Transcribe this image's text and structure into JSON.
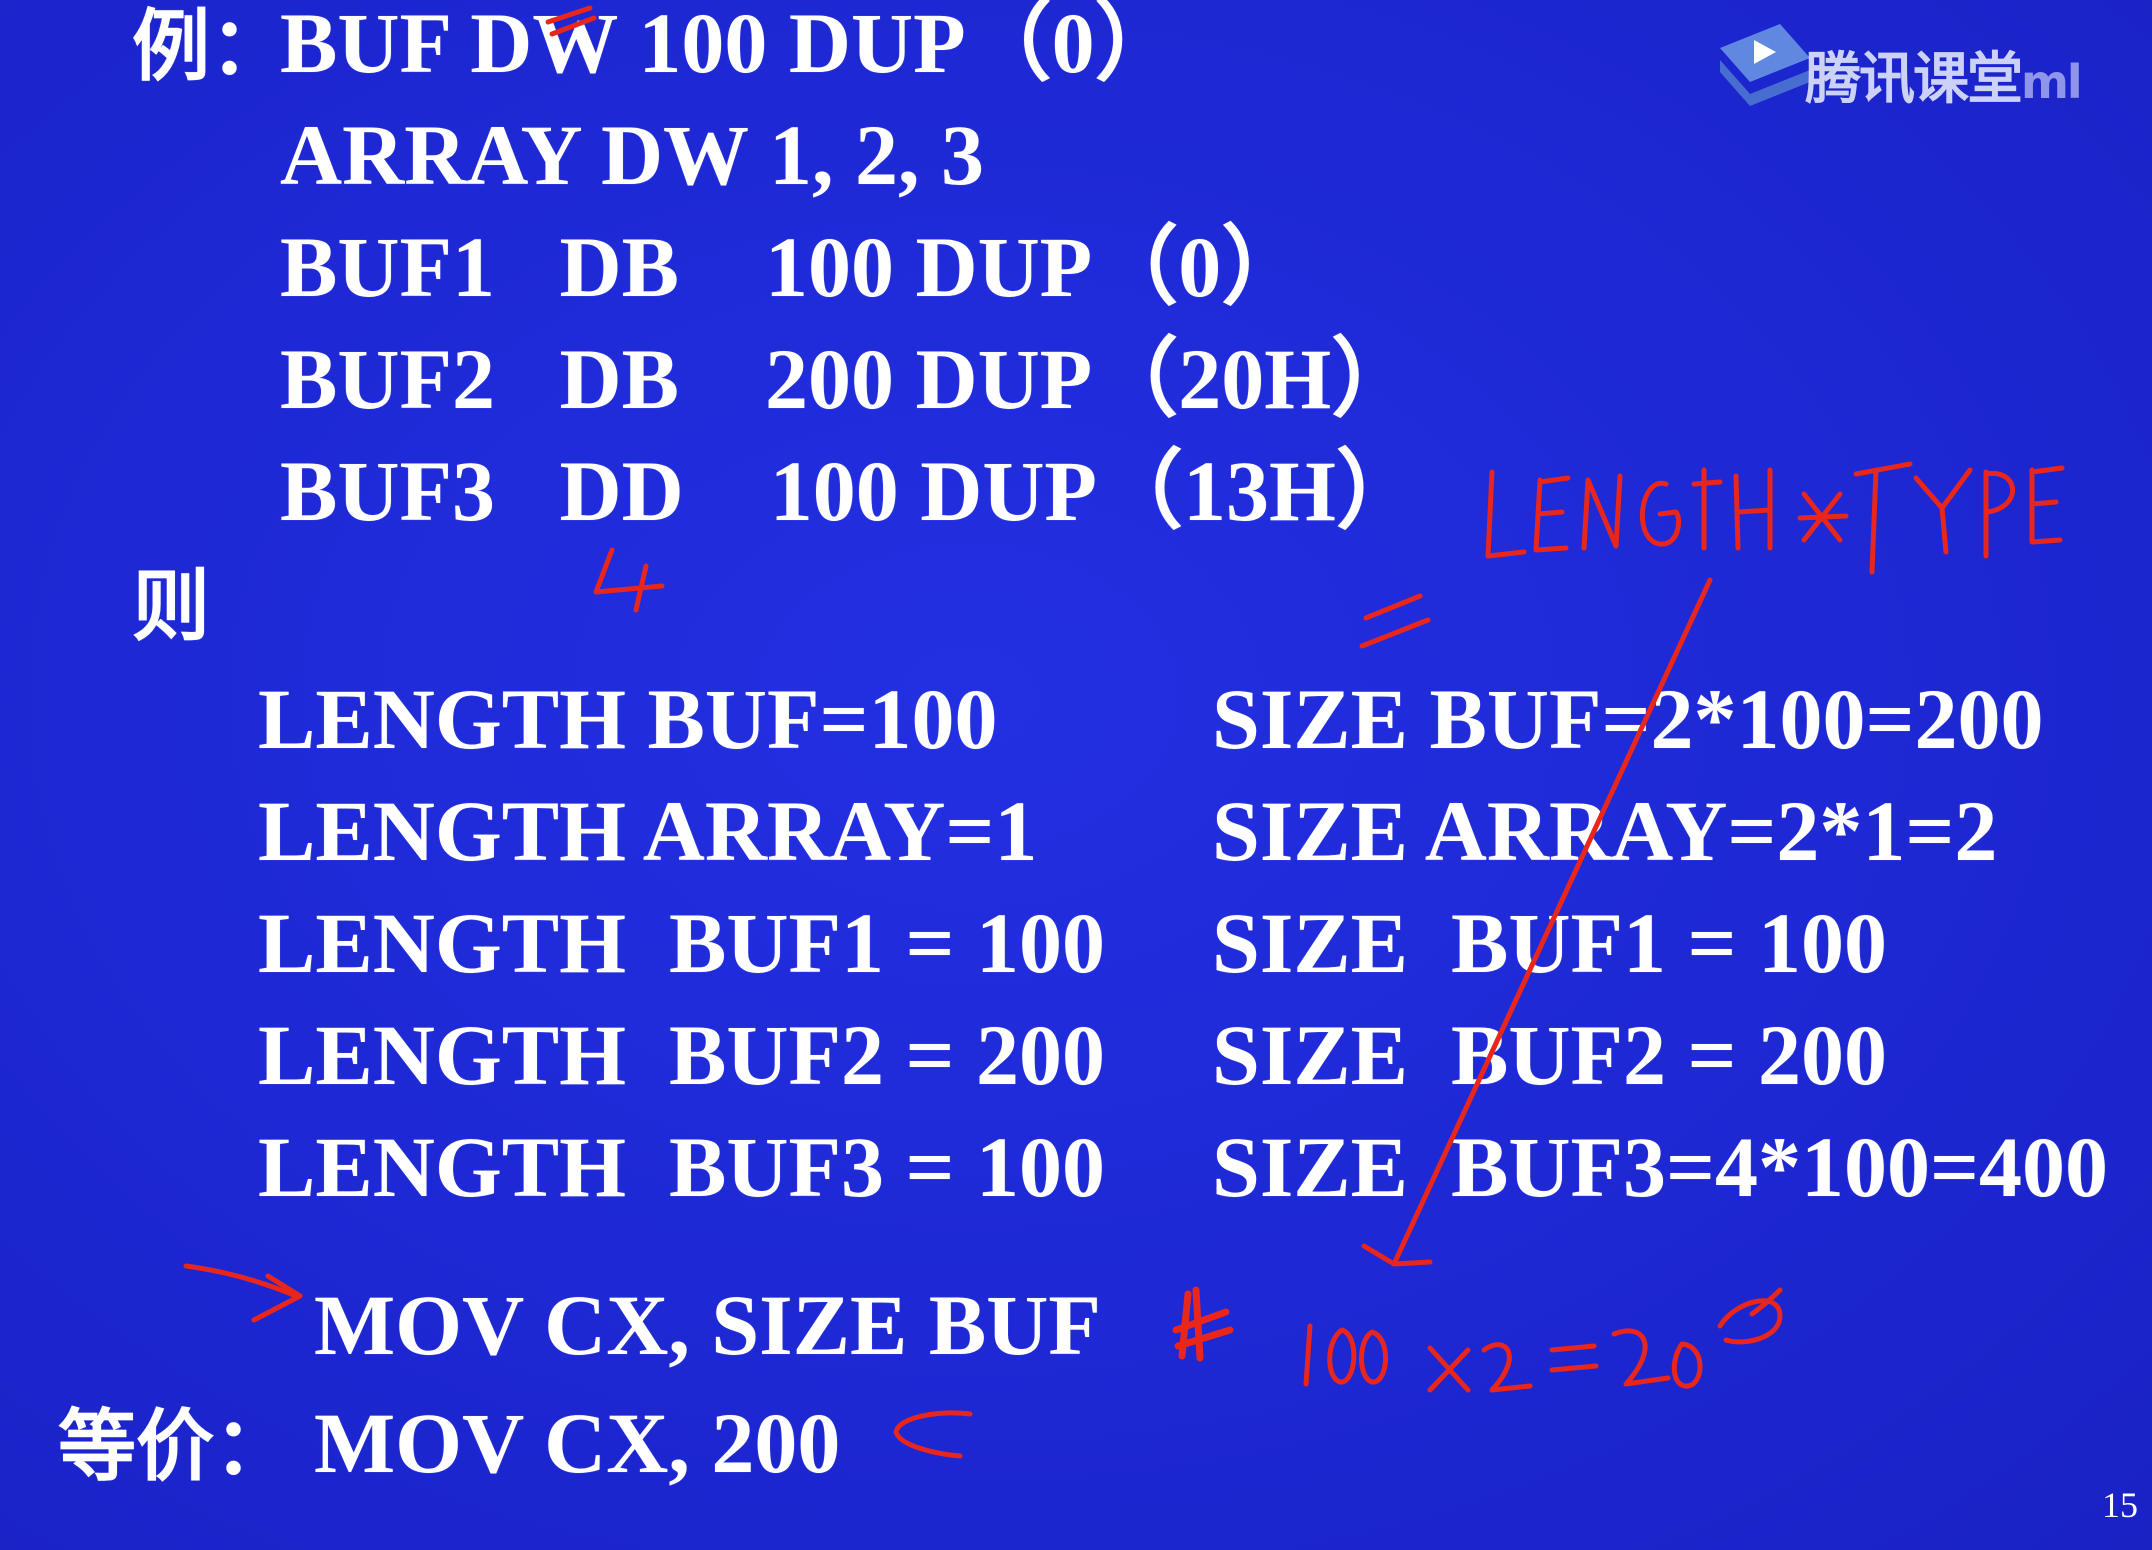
{
  "example_label": "例：",
  "lines": {
    "buf": "BUF DW 100 DUP（0）",
    "array": "ARRAY DW 1, 2, 3",
    "buf1": "BUF1   DB    100 DUP（0）",
    "buf2": "BUF2   DB    200 DUP（20H）",
    "buf3": "BUF3   DD    100 DUP（13H）"
  },
  "then_label": "则",
  "length_lines": [
    "LENGTH BUF=100",
    "LENGTH ARRAY=1",
    "LENGTH  BUF1 = 100",
    "LENGTH  BUF2 = 200",
    "LENGTH  BUF3 = 100"
  ],
  "size_lines": [
    "SIZE BUF=2*100=200",
    "SIZE ARRAY=2*1=2",
    "SIZE  BUF1 = 100",
    "SIZE  BUF2 = 200",
    "SIZE  BUF3=4*100=400"
  ],
  "mov_line": "MOV CX, SIZE BUF",
  "equiv_label": "等价：",
  "equiv_mov": "MOV CX, 200",
  "page_number": "15",
  "watermark": {
    "text": "腾讯课堂",
    "tail": "ml",
    "icon": "play-icon"
  },
  "annotations": {
    "note_length_type": "LENGTH * TYPE",
    "note_calc": "100 x2 =200",
    "note_four": "4",
    "color": "#e8261c"
  }
}
